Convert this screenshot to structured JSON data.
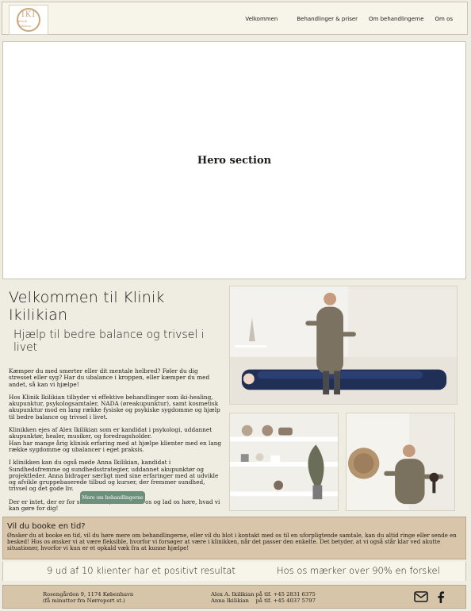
{
  "header": {
    "logo": {
      "mark": "IKI",
      "sub": "klinik ikilikian"
    },
    "nav": [
      "Velkommen",
      "Behandlinger & priser",
      "Om behandlingerne",
      "Om os"
    ]
  },
  "hero": {
    "title": "Hero section"
  },
  "welcome": {
    "title": "Velkommen til Klinik Ikilikian",
    "subtitle": "Hjælp til bedre balance og trivsel i livet",
    "paragraphs": [
      "Kæmper du med smerter eller dit mentale helbred? Føler du dig stresset eller syg? Har du ubalance i kroppen, eller kæmper du med andet, så kan vi hjælpe!",
      "Hos Klinik Ikilikian tilbyder vi effektive behandlinger som iki-healing, akupunktur, psykologsamtaler, NADA (øreakupunktur), samt kosmetisk akupunktur mod en lang række fysiske og psykiske sygdomme og hjælp til bedre balance og trivsel i livet.",
      "Klinikken ejes af Alex Ikilikian som er kandidat i psykologi, uddannet akupunktør, healer, musiker, og foredragsholder.\nHan har mange årig klinisk erfaring med at hjælpe klienter med en lang række sygdomme og ubalancer i eget praksis.",
      "I klinikken kan du også møde Anna Ikilikian, kandidat i Sundhedsfremme og sundhedsstrategier, uddannet akupunktør og projektleder. Anna bidrager særligt med sine erfaringer med at udvikle og afvikle gruppebaserede tilbud og kurser, der fremmer sundhed, trivsel og det gode liv.",
      "Der er intet, der er for stort for os, så kontakt os og lad os høre, hvad vi kan gøre for dig!"
    ],
    "cta": "Mere om behandlingerne"
  },
  "booking": {
    "title": "Vil du booke en tid?",
    "text": "Ønsker du at booke en tid, vil du høre mere om behandlingerne, eller vil du blot i kontakt med os til en uforpligtende samtale, kan du altid ringe eller sende en besked! Hos os ønsker vi at være fleksible, hvorfor vi forsøger at være i klinikken, når det passer den enkelte. Det betyder, at vi også står klar ved akutte situationer, hvorfor vi kun er et opkald væk fra at kunne hjælpe!"
  },
  "stats": {
    "left": "9 ud af 10 klienter har et positivt resultat",
    "right": "Hos os mærker over 90% en forskel"
  },
  "footer": {
    "address_line1": "Rosengården 9, 1174 København",
    "address_line2": "(få minutter fra Nørreport st.)",
    "contact_line1": "Alex A. Ikilikian på tlf. +45 2831 6375",
    "contact_line2": "Anna Ikilikian    på tlf. +45 4037 5797",
    "icons": [
      "mail-icon",
      "facebook-icon"
    ]
  }
}
